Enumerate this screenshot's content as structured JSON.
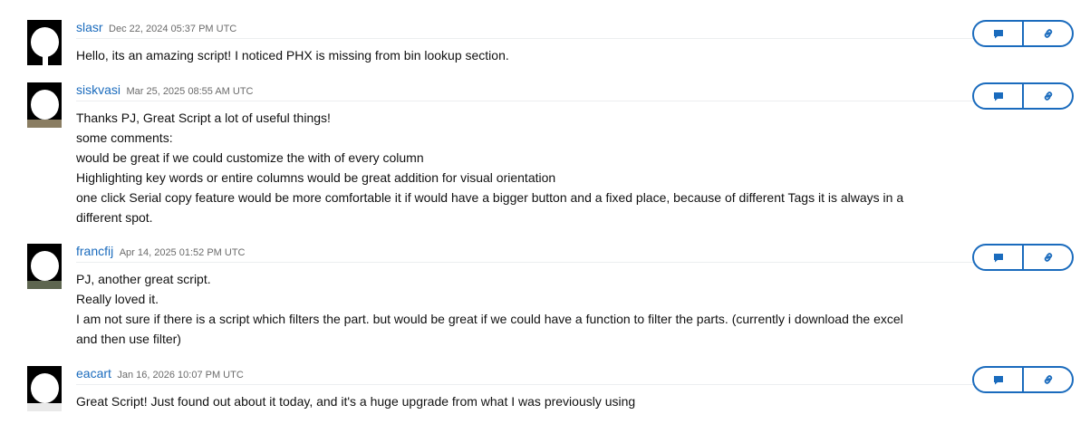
{
  "comments": [
    {
      "author": "slasr",
      "date": "Dec 22, 2024 05:37 PM UTC",
      "lines": [
        "Hello, its an amazing script! I noticed PHX is missing from bin lookup section."
      ]
    },
    {
      "author": "siskvasi",
      "date": "Mar 25, 2025 08:55 AM UTC",
      "lines": [
        "Thanks PJ, Great Script a lot of useful things!",
        "some comments:",
        "would be great if we could customize the with of every column",
        "Highlighting key words or entire columns would be great addition for visual orientation",
        "one click Serial copy feature would be more comfortable it if would have a bigger button and a fixed place, because of different Tags it is always in a",
        "different spot."
      ]
    },
    {
      "author": "francfij",
      "date": "Apr 14, 2025 01:52 PM UTC",
      "lines": [
        "PJ, another great script.",
        "Really loved it.",
        "I am not sure if there is a script which filters the part. but would be great if we could have a function to filter the parts. (currently i download the excel",
        "and then use filter)"
      ]
    },
    {
      "author": "eacart",
      "date": "Jan 16, 2026 10:07 PM UTC",
      "lines": [
        "Great Script! Just found out about it today, and it's a huge upgrade from what I was previously using"
      ]
    }
  ],
  "icons": {
    "reply": "comment-icon",
    "link": "link-icon"
  },
  "colors": {
    "accent": "#1a6bbd",
    "date": "#6b6b6b",
    "text": "#111111"
  }
}
